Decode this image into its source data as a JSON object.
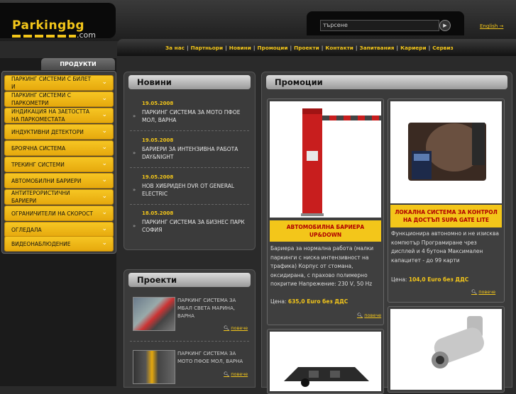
{
  "header": {
    "logo_text": "Parkingbg",
    "logo_suffix": ".com",
    "search_placeholder": "търсене",
    "language_link": "English"
  },
  "nav": {
    "items": [
      "За нас",
      "Партньори",
      "Новини",
      "Промоции",
      "Проекти",
      "Контакти",
      "Запитвания",
      "Кариери",
      "Сервиз"
    ]
  },
  "sidebar": {
    "tab_label": "ПРОДУКТИ",
    "items": [
      {
        "label": "ПАРКИНГ СИСТЕМИ С БИЛЕТ И"
      },
      {
        "label": "ПАРКИНГ СИСТЕМИ С ПАРКОМЕТРИ"
      },
      {
        "label": "ИНДИКАЦИЯ НА ЗАЕТОСТТА НА ПАРКОМЕСТАТА"
      },
      {
        "label": "ИНДУКТИВНИ ДЕТЕКТОРИ"
      },
      {
        "label": "БРОЯЧНА СИСТЕМА"
      },
      {
        "label": "ТРЕКИНГ СИСТЕМИ"
      },
      {
        "label": "АВТОМОБИЛНИ БАРИЕРИ"
      },
      {
        "label": "АНТИТЕРОРИСТИЧНИ БАРИЕРИ"
      },
      {
        "label": "ОГРАНИЧИТЕЛИ НА СКОРОСТ"
      },
      {
        "label": "ОГЛЕДАЛА"
      },
      {
        "label": "ВИДЕОНАБЛЮДЕНИЕ"
      }
    ]
  },
  "news": {
    "title": "Новини",
    "items": [
      {
        "date": "19.05.2008",
        "text": "ПАРКИНГ СИСТЕМА ЗА МОТО ПФОЕ МОЛ, ВАРНА"
      },
      {
        "date": "19.05.2008",
        "text": "БАРИЕРИ ЗА ИНТЕНЗИВНА РАБОТА DAY&NIGHT"
      },
      {
        "date": "19.05.2008",
        "text": "НОВ ХИБРИДЕН DVR ОТ GENERAL ELECTRIC"
      },
      {
        "date": "18.05.2008",
        "text": "ПАРКИНГ СИСТЕМА ЗА БИЗНЕС ПАРК СОФИЯ"
      }
    ]
  },
  "projects": {
    "title": "Проекти",
    "items": [
      {
        "text": "ПАРКИНГ СИСТЕМА ЗА МБАЛ СВЕТА МАРИНА, ВАРНА",
        "more": "повече"
      },
      {
        "text": "ПАРКИНГ СИСТЕМА ЗА МОТО ПФОЕ МОЛ, ВАРНА",
        "more": "повече"
      }
    ]
  },
  "promotions": {
    "title": "Промоции",
    "cards": [
      {
        "title": "АВТОМОБИЛНА БАРИЕРА UP&DOWN",
        "description": "Бариера за нормална работа (малки паркинги с ниска интензивност на трафика) Корпус от стомана, оксидирана, с прахово полимерно покритие Напрежение: 230 V, 50 Hz",
        "price_label": "Цена:",
        "price": "635,0 Euro без ДДС",
        "more": "повече"
      },
      {
        "title": "ЛОКАЛНА СИСТЕМА ЗА КОНТРОЛ НА ДОСТЪП SUPA GATE LITE",
        "description": "Функционира автономно и не изисква компютър Програмиране чрез дисплей и 4 бутона Максимален капацитет - до 99 карти",
        "price_label": "Цена:",
        "price": "104,0 Euro без ДДС",
        "more": "повече"
      }
    ]
  }
}
